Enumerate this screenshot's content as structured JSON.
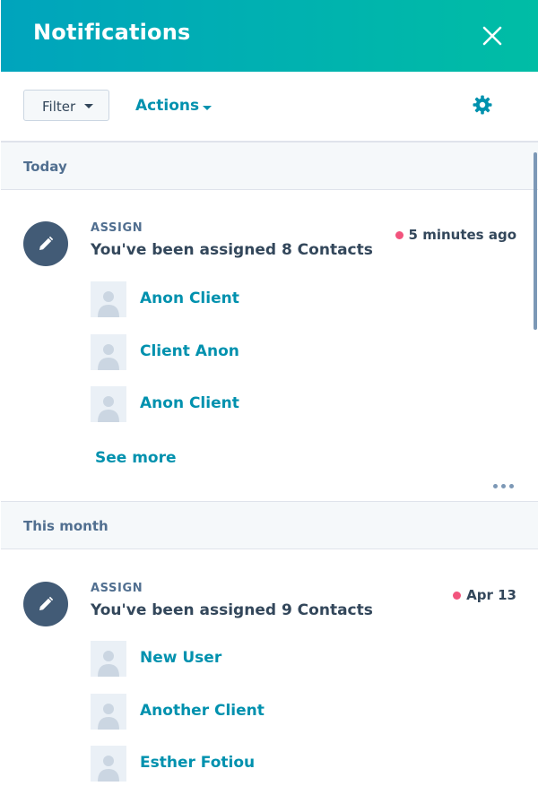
{
  "header": {
    "title": "Notifications",
    "close_icon": "close-icon"
  },
  "toolbar": {
    "filter_label": "Filter",
    "actions_label": "Actions",
    "settings_icon": "gear-icon"
  },
  "sections": [
    {
      "label": "Today",
      "notification": {
        "category": "ASSIGN",
        "title": "You've been assigned 8 Contacts",
        "time": "5 minutes ago",
        "contacts": [
          "Anon Client",
          "Client Anon",
          "Anon Client"
        ],
        "see_more": "See more"
      }
    },
    {
      "label": "This month",
      "notification": {
        "category": "ASSIGN",
        "title": "You've been assigned 9 Contacts",
        "time": "Apr 13",
        "contacts": [
          "New User",
          "Another Client",
          "Esther Fotiou"
        ]
      }
    }
  ],
  "colors": {
    "header_gradient_start": "#00a4bd",
    "header_gradient_end": "#00bda5",
    "link": "#0091ae",
    "unread_dot": "#f2547d",
    "avatar_bg": "#425b76"
  }
}
